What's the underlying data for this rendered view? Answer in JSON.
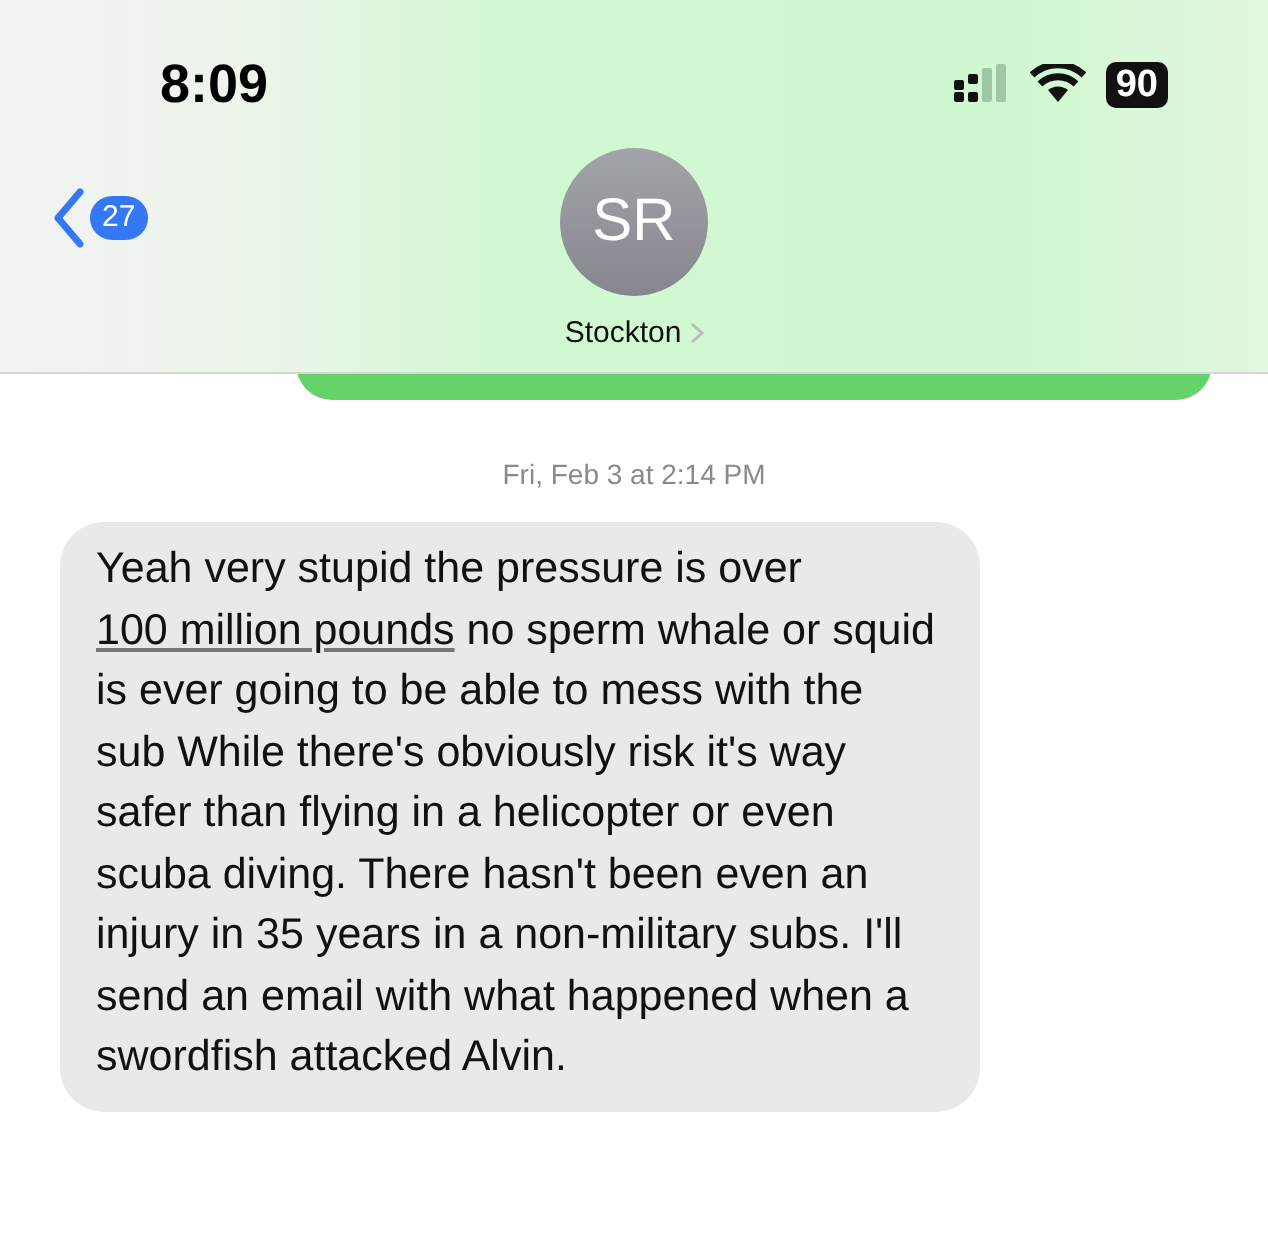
{
  "status_bar": {
    "time": "8:09",
    "battery": "90"
  },
  "header": {
    "back_count": "27",
    "avatar_initials": "SR",
    "contact_name": "Stockton"
  },
  "timestamp": "Fri, Feb 3 at 2:14 PM",
  "message": {
    "parts": [
      {
        "kind": "text",
        "text": "Yeah very stupid the pressure is over "
      },
      {
        "kind": "link",
        "text": "100 million pounds"
      },
      {
        "kind": "text",
        "text": " no sperm whale or squid is ever going to be able to mess with the sub While there's obviously risk it's way safer than flying in a helicopter or even scuba diving. There hasn't been even an injury in 35 years in a non-military subs. I'll send an email with what happened when a swordfish attacked Alvin."
      }
    ]
  }
}
